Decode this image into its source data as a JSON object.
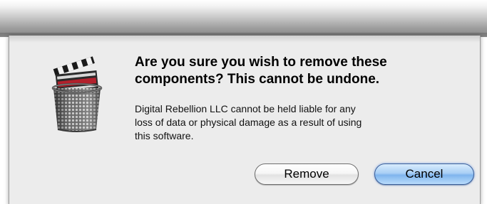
{
  "dialog": {
    "title_lines": [
      "Are you sure you wish to remove these",
      "components? This cannot be undone."
    ],
    "message_lines": [
      "Digital Rebellion LLC cannot be held liable for any",
      "loss of data or physical damage as a result of using",
      "this software."
    ],
    "icon": "trash-can-clapperboard-icon"
  },
  "buttons": {
    "remove_label": "Remove",
    "cancel_label": "Cancel"
  },
  "colors": {
    "sheet_background": "#ececec",
    "default_button": "#8fc0f0"
  }
}
